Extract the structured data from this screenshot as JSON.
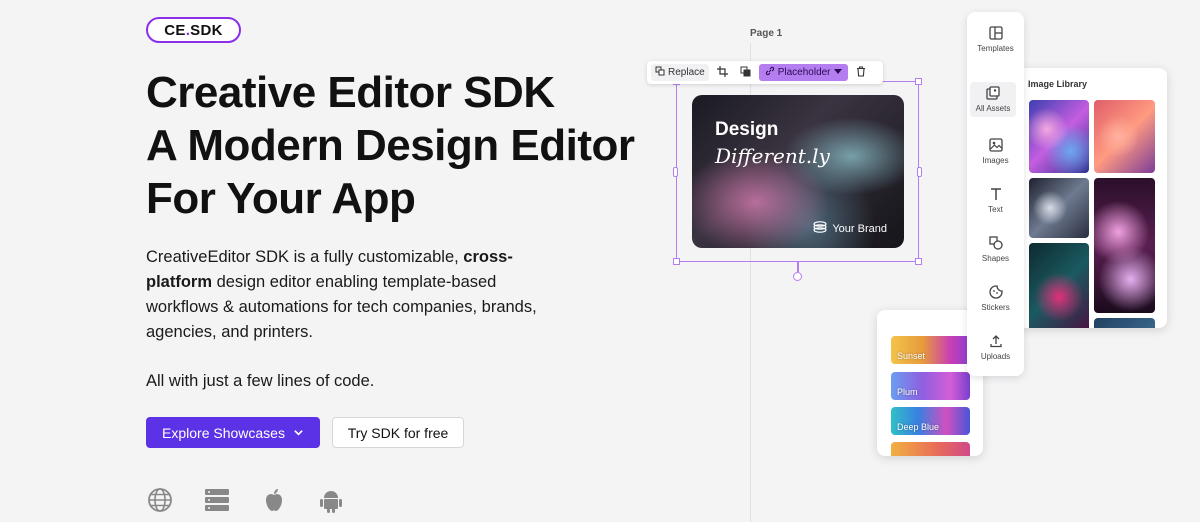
{
  "logo": {
    "prefix": "CE",
    "dot": ".",
    "suffix": "SDK"
  },
  "headline": {
    "line1": "Creative Editor SDK",
    "line2": "A Modern Design Editor",
    "line3": "For Your App"
  },
  "description": {
    "part1": "CreativeEditor SDK is a fully customizable, ",
    "bold": "cross-platform",
    "part2": " design editor enabling template-based workflows & automations for tech companies, brands, agencies, and printers."
  },
  "tagline": "All with just a few lines of code.",
  "buttons": {
    "explore": "Explore Showcases",
    "try": "Try SDK for free"
  },
  "platform_icons": [
    "globe-icon",
    "server-icon",
    "apple-icon",
    "android-icon"
  ],
  "editor": {
    "page_label": "Page 1",
    "toolbar": {
      "replace": "Replace",
      "placeholder": "Placeholder"
    },
    "card": {
      "title": "Design",
      "subtitle": "Different.ly",
      "brand": "Your Brand"
    },
    "asset_bar": [
      {
        "label": "Templates",
        "icon": "templates-icon"
      },
      {
        "label": "All Assets",
        "icon": "all-assets-icon"
      },
      {
        "label": "Images",
        "icon": "images-icon"
      },
      {
        "label": "Text",
        "icon": "text-icon"
      },
      {
        "label": "Shapes",
        "icon": "shapes-icon"
      },
      {
        "label": "Stickers",
        "icon": "stickers-icon"
      },
      {
        "label": "Uploads",
        "icon": "uploads-icon"
      }
    ],
    "library_title": "Image Library",
    "filters": [
      "Sunset",
      "Plum",
      "Deep Blue"
    ]
  },
  "colors": {
    "accent": "#5b32e6",
    "logo_border": "#8b2ee8",
    "selection": "#b57ef0",
    "background": "#f4f4f5"
  }
}
